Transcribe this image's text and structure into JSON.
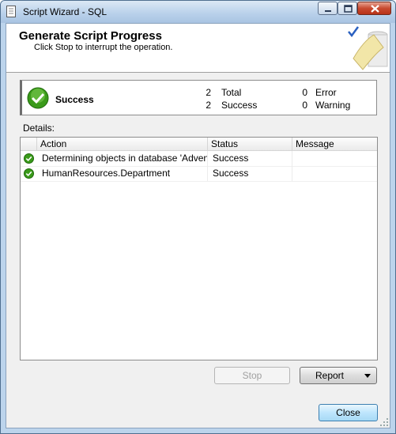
{
  "window": {
    "title": "Script Wizard - SQL"
  },
  "header": {
    "title": "Generate Script Progress",
    "subtitle": "Click Stop to interrupt the operation."
  },
  "summary": {
    "status": "Success",
    "total_count": "2",
    "total_label": "Total",
    "success_count": "2",
    "success_label": "Success",
    "error_count": "0",
    "error_label": "Error",
    "warning_count": "0",
    "warning_label": "Warning"
  },
  "details": {
    "label": "Details:",
    "columns": [
      "Action",
      "Status",
      "Message"
    ],
    "rows": [
      {
        "action": "Determining objects in database 'Advent...",
        "status": "Success",
        "message": ""
      },
      {
        "action": "HumanResources.Department",
        "status": "Success",
        "message": ""
      }
    ]
  },
  "buttons": {
    "stop": "Stop",
    "report": "Report",
    "close": "Close"
  },
  "colors": {
    "success_green": "#3a9a1a",
    "titlebar": "#b8d0ea",
    "close_red": "#c84a30"
  }
}
